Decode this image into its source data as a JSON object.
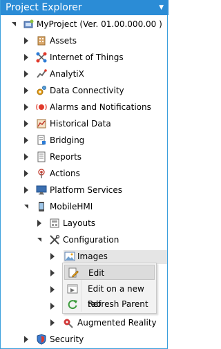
{
  "panel": {
    "title": "Project Explorer"
  },
  "tree": {
    "root": "MyProject (Ver. 01.00.000.00 )",
    "assets": "Assets",
    "iot": "Internet of Things",
    "analytix": "AnalytiX",
    "data_connectivity": "Data Connectivity",
    "alarms": "Alarms and Notifications",
    "historical": "Historical Data",
    "bridging": "Bridging",
    "reports": "Reports",
    "actions": "Actions",
    "platform": "Platform Services",
    "mobilehmi": "MobileHMI",
    "layouts": "Layouts",
    "configuration": "Configuration",
    "images": "Images",
    "augmented_reality": "Augmented Reality",
    "security": "Security"
  },
  "context_menu": {
    "edit": "Edit",
    "edit_new_tab": "Edit on a new tab",
    "refresh_parent": "Refresh Parent"
  }
}
